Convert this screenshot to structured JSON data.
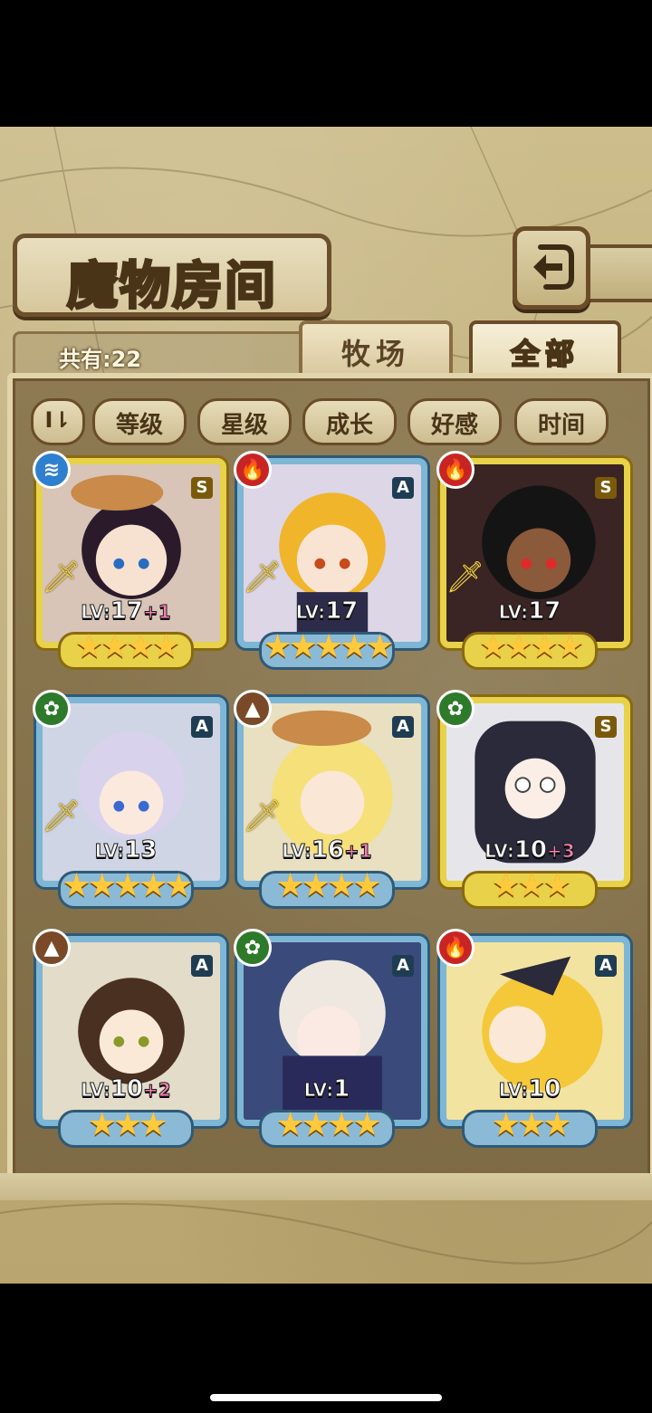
{
  "title": "魔物房间",
  "count_label": "共有:22",
  "tabs": [
    {
      "label": "牧场",
      "active": false
    },
    {
      "label": "全部",
      "active": true
    }
  ],
  "sort_toggle_label": "I⇂",
  "sort_buttons": [
    "等级",
    "星级",
    "成长",
    "好感",
    "时间"
  ],
  "monsters": [
    {
      "element": "water",
      "rank": "S",
      "frame": "gold",
      "lv_label": "LV:",
      "lv": "17",
      "plus": "+1",
      "stars": "★★★★",
      "star_count": 4
    },
    {
      "element": "fire",
      "rank": "A",
      "frame": "blue",
      "lv_label": "LV:",
      "lv": "17",
      "plus": "",
      "stars": "★★★★★",
      "star_count": 5
    },
    {
      "element": "fire",
      "rank": "S",
      "frame": "gold",
      "lv_label": "LV:",
      "lv": "17",
      "plus": "",
      "stars": "★★★★",
      "star_count": 4
    },
    {
      "element": "wood",
      "rank": "A",
      "frame": "blue",
      "lv_label": "LV:",
      "lv": "13",
      "plus": "",
      "stars": "★★★★★",
      "star_count": 5
    },
    {
      "element": "earth",
      "rank": "A",
      "frame": "blue",
      "lv_label": "LV:",
      "lv": "16",
      "plus": "+1",
      "stars": "★★★★",
      "star_count": 4
    },
    {
      "element": "wood",
      "rank": "S",
      "frame": "gold",
      "lv_label": "LV:",
      "lv": "10",
      "plus": "+3",
      "stars": "★★★",
      "star_count": 3
    },
    {
      "element": "earth",
      "rank": "A",
      "frame": "blue",
      "lv_label": "LV:",
      "lv": "10",
      "plus": "+2",
      "stars": "★★★",
      "star_count": 3
    },
    {
      "element": "wood",
      "rank": "A",
      "frame": "blue",
      "lv_label": "LV:",
      "lv": "1",
      "plus": "",
      "stars": "★★★★",
      "star_count": 4
    },
    {
      "element": "fire",
      "rank": "A",
      "frame": "blue",
      "lv_label": "LV:",
      "lv": "10",
      "plus": "",
      "stars": "★★★",
      "star_count": 3
    }
  ],
  "colors": {
    "water": "#2f7fd0",
    "fire": "#c82424",
    "wood": "#2d7a2a",
    "earth": "#7a4a28",
    "gold_frame": "#e7d24a",
    "blue_frame": "#7eb6d6",
    "star": "#ffc93c"
  }
}
